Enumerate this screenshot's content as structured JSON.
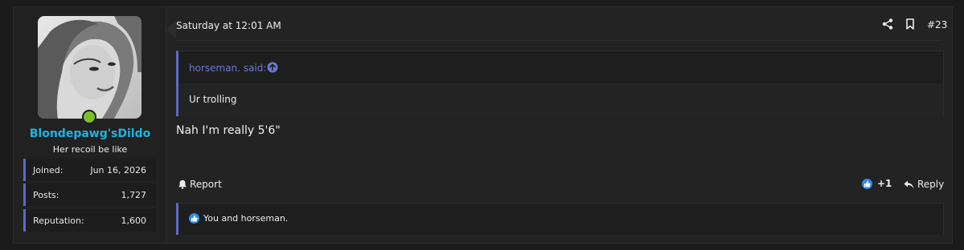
{
  "user": {
    "username": "Blondepawg'sDildo",
    "title": "Her recoil be like",
    "stats": [
      {
        "label": "Joined:",
        "value": "Jun 16, 2026"
      },
      {
        "label": "Posts:",
        "value": "1,727"
      },
      {
        "label": "Reputation:",
        "value": "1,600"
      }
    ],
    "online_color": "#7cc02a"
  },
  "post": {
    "date": "Saturday at 12:01 AM",
    "number": "#23",
    "quote": {
      "author": "horseman. said:",
      "text": "Ur trolling"
    },
    "message": "Nah I'm really 5'6\"",
    "actions": {
      "report": "Report",
      "reaction_count": "+1",
      "reply": "Reply"
    },
    "reactions_text": "You and horseman."
  },
  "colors": {
    "accent": "#5d69c7",
    "username": "#22b3e0",
    "like": "#2e8de6"
  },
  "icons": [
    "share-icon",
    "bookmark-icon",
    "arrow-up-circle-icon",
    "bell-icon",
    "like-icon",
    "reply-icon"
  ]
}
